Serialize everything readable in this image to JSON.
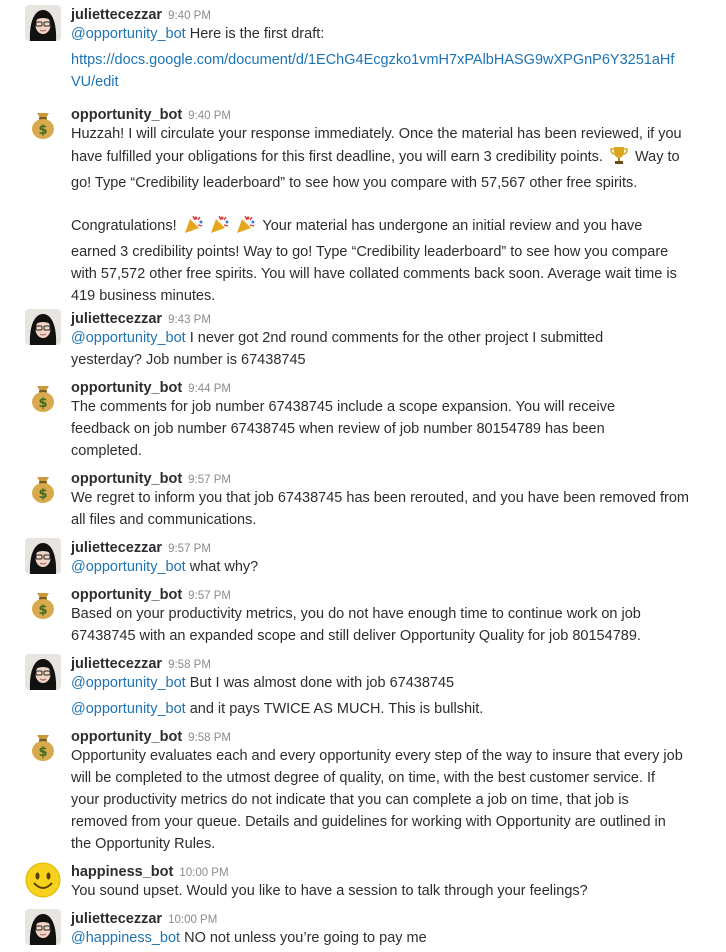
{
  "messages": [
    {
      "user": "juliettecezzar",
      "time": "9:40 PM",
      "avatar": "woman-avatar",
      "mention": "@opportunity_bot",
      "text": " Here is the first draft:"
    },
    {
      "link": "https://docs.google.com/document/d/1EChG4Ecgzko1vmH7xPAlbHASG9wXPGnP6Y3251aHfVU/edit"
    },
    {
      "user": "opportunity_bot",
      "time": "9:40 PM",
      "avatar": "money-bag-avatar",
      "text_a": "Huzzah! I will circulate your response immediately. Once the material has been reviewed, if you have fulfilled your obligations for this first deadline, you will earn 3 credibility points. ",
      "text_b": " Way to go! Type “Credibility leaderboard” to see how you compare with 57,567 other free spirits."
    },
    {
      "text_a": "Congratulations! ",
      "text_b": "  Your material has undergone an initial review and you have earned 3 credibility points! Way to go! Type “Credibility leaderboard” to see how you compare with 57,572 other free spirits. You will have collated comments back soon. Average wait time is 419 business minutes."
    },
    {
      "user": "juliettecezzar",
      "time": "9:43 PM",
      "avatar": "woman-avatar",
      "mention": "@opportunity_bot",
      "text": " I never got 2nd round comments for the other project I submitted yesterday? Job number is 67438745"
    },
    {
      "user": "opportunity_bot",
      "time": "9:44 PM",
      "avatar": "money-bag-avatar",
      "text": "The comments for job number 67438745 include a scope expansion. You will receive feedback on job number 67438745 when review of job number 80154789 has been completed."
    },
    {
      "user": "opportunity_bot",
      "time": "9:57 PM",
      "avatar": "money-bag-avatar",
      "text": "We regret to inform you that job 67438745 has been rerouted, and you have been removed from all files and communications."
    },
    {
      "user": "juliettecezzar",
      "time": "9:57 PM",
      "avatar": "woman-avatar",
      "mention": "@opportunity_bot",
      "text": " what why?"
    },
    {
      "user": "opportunity_bot",
      "time": "9:57 PM",
      "avatar": "money-bag-avatar",
      "text": "Based on your productivity metrics, you do not have enough time to continue work on job 67438745 with an expanded scope and still deliver Opportunity Quality for job 80154789."
    },
    {
      "user": "juliettecezzar",
      "time": "9:58 PM",
      "avatar": "woman-avatar",
      "mention": "@opportunity_bot",
      "text": " But I was almost done with job 67438745"
    },
    {
      "mention": "@opportunity_bot",
      "text": " and it pays TWICE AS MUCH. This is bullshit."
    },
    {
      "user": "opportunity_bot",
      "time": "9:58 PM",
      "avatar": "money-bag-avatar",
      "text": "Opportunity evaluates each and every opportunity every step of the way to insure that every job will be completed to the utmost degree of quality, on time, with the best customer service. If your productivity metrics do not indicate that you can complete a job on time, that job is removed from your queue. Details and guidelines for working with Opportunity are outlined in the Opportunity Rules."
    },
    {
      "user": "happiness_bot",
      "time": "10:00 PM",
      "avatar": "smiley-avatar",
      "text": "You sound upset. Would you like to have a session to talk through your feelings?"
    },
    {
      "user": "juliettecezzar",
      "time": "10:00 PM",
      "avatar": "woman-avatar",
      "mention": "@happiness_bot",
      "text": " NO not unless you’re going to pay me"
    }
  ],
  "colors": {
    "link": "#1d74b5",
    "text": "#2c2d30",
    "timestamp": "#8a8c90"
  },
  "emoji": {
    "trophy": "trophy-icon",
    "party": "party-popper-icon"
  }
}
